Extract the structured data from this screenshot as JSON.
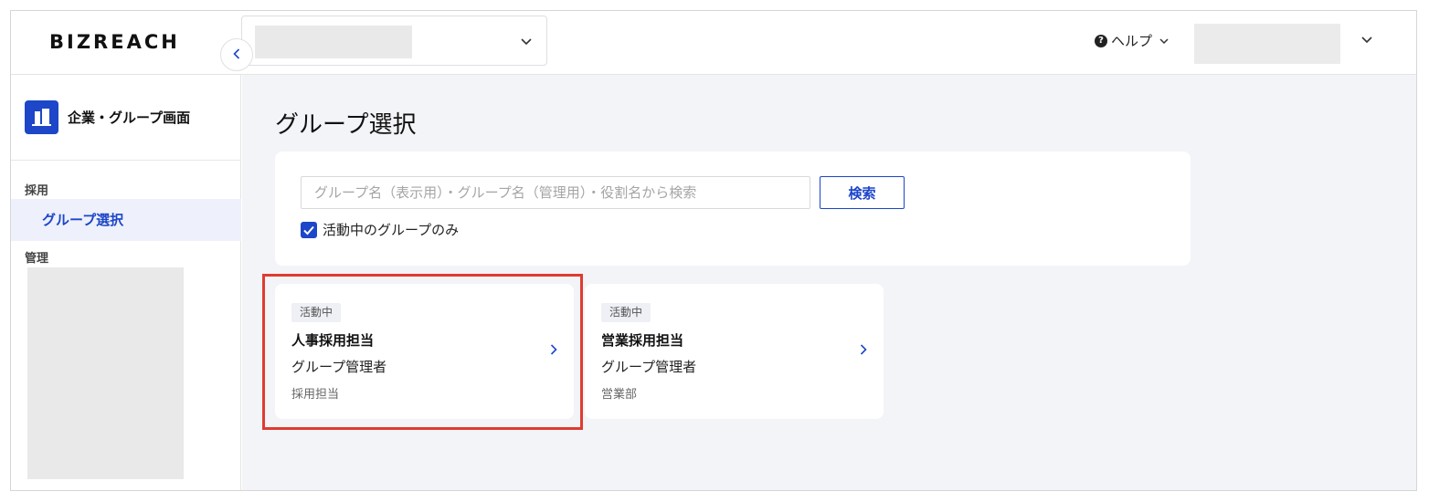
{
  "header": {
    "logo": "BIZREACH",
    "company_select_chevron_icon": "chevron-down-icon",
    "help_label": "ヘルプ",
    "help_icon": "question-circle-icon",
    "user_menu_chevron_icon": "chevron-down-icon"
  },
  "sidebar": {
    "title": "企業・グループ画面",
    "title_icon": "building-icon",
    "collapse_icon": "chevron-left-icon",
    "sections": [
      {
        "label": "採用",
        "items": [
          {
            "label": "グループ選択",
            "active": true
          }
        ]
      },
      {
        "label": "管理",
        "items": []
      }
    ]
  },
  "main": {
    "title": "グループ選択",
    "search": {
      "placeholder": "グループ名（表示用）・グループ名（管理用）・役割名から検索",
      "value": "",
      "button_label": "検索",
      "active_only_label": "活動中のグループのみ",
      "active_only_checked": true
    },
    "cards": [
      {
        "status": "活動中",
        "name": "人事採用担当",
        "role": "グループ管理者",
        "department": "採用担当",
        "highlighted": true
      },
      {
        "status": "活動中",
        "name": "営業採用担当",
        "role": "グループ管理者",
        "department": "営業部",
        "highlighted": false
      }
    ]
  },
  "colors": {
    "accent": "#1d46c8",
    "highlight_border": "#e03b30",
    "main_background": "#f3f4f8"
  }
}
